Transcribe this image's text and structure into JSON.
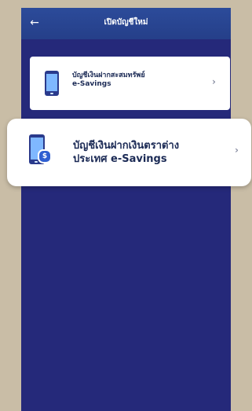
{
  "header": {
    "title": "เปิดบัญชีใหม่",
    "back_icon": "←"
  },
  "cards": [
    {
      "line1": "บัญชีเงินฝากสะสมทรัพย์",
      "line2": "e-Savings",
      "icon": "mobile-phone-icon",
      "chevron": "›"
    },
    {
      "line1": "บัญชีเงินฝากเงินตราต่าง",
      "line2": "ประเทศ e-Savings",
      "icon": "mobile-phone-currency-icon",
      "coin_symbol": "$",
      "chevron": "›"
    }
  ]
}
